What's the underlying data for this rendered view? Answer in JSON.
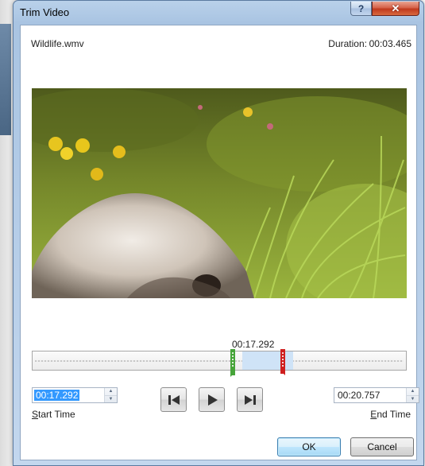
{
  "window": {
    "title": "Trim Video",
    "help_symbol": "?",
    "close_symbol": "✕"
  },
  "media": {
    "filename": "Wildlife.wmv",
    "duration_label": "Duration:",
    "duration_value": "00:03.465"
  },
  "timeline": {
    "current_time": "00:17.292",
    "start_handle_color": "#46a43a",
    "end_handle_color": "#cf1f1f",
    "selection_color": "#cfe3f7"
  },
  "start_time": {
    "value": "00:17.292",
    "label_access": "S",
    "label_rest": "tart Time"
  },
  "end_time": {
    "value": "00:20.757",
    "label_access": "E",
    "label_rest": "nd Time"
  },
  "controls": {
    "previous_frame_icon": "previous-frame-icon",
    "play_icon": "play-icon",
    "next_frame_icon": "next-frame-icon"
  },
  "buttons": {
    "ok": "OK",
    "cancel": "Cancel"
  },
  "colors": {
    "titlebar": "#b9d1ea",
    "close_button": "#c0391d",
    "ok_border": "#3c7fb1"
  }
}
